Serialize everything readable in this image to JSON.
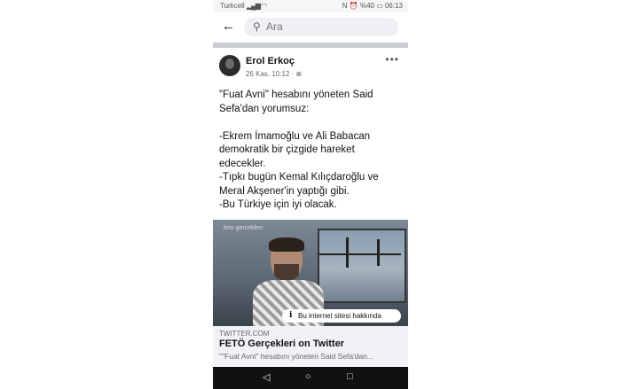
{
  "status": {
    "carrier": "Turkcell",
    "signal": "▂▄▆ ◠",
    "right": "N ⏰ %40 ▭ 06:13"
  },
  "search": {
    "back_icon": "arrow-left-icon",
    "placeholder": "Ara"
  },
  "post": {
    "author": "Erol Erkoç",
    "meta": "26 Kas, 10:12 · ⊕",
    "more": "•••",
    "lines": [
      "\"Fuat Avni\" hesabını yöneten Said Sefa'dan yorumsuz:",
      "",
      "-Ekrem İmamoğlu ve Ali Babacan demokratik bir çizgide hareket edecekler.",
      "-Tıpkı bugün Kemal Kılıçdaroğlu ve Meral Akşener'in yaptığı gibi.",
      "-Bu Türkiye için iyi olacak."
    ],
    "media_watermark": "feto gercekleri",
    "info_pill": "Bu internet sitesi hakkında",
    "link": {
      "domain": "TWITTER.COM",
      "title": "FETÖ Gerçekleri on Twitter",
      "subtitle": "\"\"Fuat Avni\" hesabını yöneten Said Sefa'dan..."
    }
  },
  "navbar": {
    "back": "◁",
    "home": "○",
    "recents": "□"
  }
}
